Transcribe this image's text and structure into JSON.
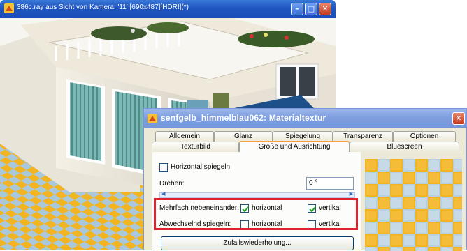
{
  "render_window": {
    "title": "386c.ray aus Sicht von Kamera: '11' [690x487][HDRI](*)",
    "minimize_glyph": "–",
    "maximize_glyph": "□",
    "close_glyph": "✕"
  },
  "dialog": {
    "title": "senfgelb_himmelblau062: Materialtextur",
    "close_glyph": "✕",
    "tabs_row1": [
      "Allgemein",
      "Glanz",
      "Spiegelung",
      "Transparenz",
      "Optionen"
    ],
    "tabs_row2": [
      "Texturbild",
      "Größe und Ausrichtung",
      "Bluescreen"
    ],
    "active_tab": "Größe und Ausrichtung",
    "horizontal_spiegeln_label": "Horizontal spiegeln",
    "horizontal_spiegeln_checked": false,
    "drehen_label": "Drehen:",
    "drehen_value": "0 °",
    "mehrfach_label": "Mehrfach nebeneinander:",
    "mehrfach_horizontal_label": "horizontal",
    "mehrfach_horizontal_checked": true,
    "mehrfach_vertikal_label": "vertikal",
    "mehrfach_vertikal_checked": true,
    "abwechselnd_label": "Abwechselnd spiegeln:",
    "abwechselnd_horizontal_label": "horizontal",
    "abwechselnd_horizontal_checked": false,
    "abwechselnd_vertikal_label": "vertikal",
    "abwechselnd_vertikal_checked": false,
    "zufall_button_label": "Zufallswiederholung..."
  },
  "colors": {
    "tile_yellow": "#f2b420",
    "tile_blue": "#a9c8dc",
    "highlight_red": "#e0202a",
    "titlebar_blue": "#1f55c0"
  }
}
